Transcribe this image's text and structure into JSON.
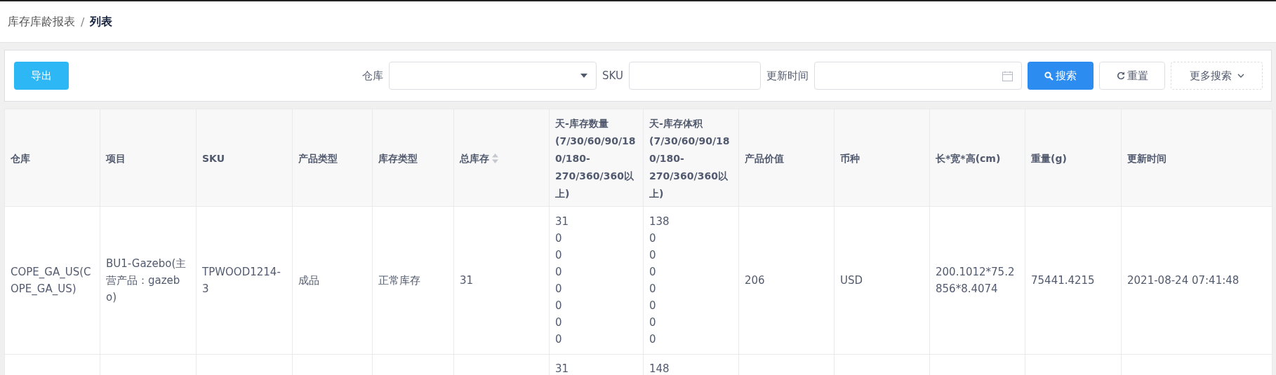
{
  "breadcrumb": {
    "items": [
      {
        "label": "库存库龄报表",
        "current": false
      },
      {
        "label": "列表",
        "current": true
      }
    ],
    "separator": "/"
  },
  "toolbar": {
    "export_button": "导出",
    "filters": [
      {
        "kind": "select",
        "label": "仓库"
      },
      {
        "kind": "text",
        "label": "SKU"
      },
      {
        "kind": "date",
        "label": "更新时间"
      }
    ],
    "search_button": "搜索",
    "reset_button": "重置",
    "more_button": "更多搜索"
  },
  "table": {
    "columns": [
      {
        "label": "仓库",
        "sortable": false
      },
      {
        "label": "项目",
        "sortable": false
      },
      {
        "label": "SKU",
        "sortable": false
      },
      {
        "label": "产品类型",
        "sortable": false
      },
      {
        "label": "库存类型",
        "sortable": false
      },
      {
        "label": "总库存",
        "sortable": true
      },
      {
        "label": "天-库存数量 (7/30/60/90/180/180-270/360/360以上)",
        "sortable": false
      },
      {
        "label": "天-库存体积 (7/30/60/90/180/180-270/360/360以上)",
        "sortable": false
      },
      {
        "label": "产品价值",
        "sortable": false
      },
      {
        "label": "币种",
        "sortable": false
      },
      {
        "label": "长*宽*高(cm)",
        "sortable": false
      },
      {
        "label": "重量(g)",
        "sortable": false
      },
      {
        "label": "更新时间",
        "sortable": false
      }
    ],
    "rows": [
      {
        "cells": [
          [
            "COPE_GA_US(COPE_GA_US)"
          ],
          [
            "BU1-Gazebo(主营产品：gazebo)"
          ],
          [
            "TPWOOD1214-3"
          ],
          [
            "成品"
          ],
          [
            "正常库存"
          ],
          [
            "31"
          ],
          [
            "31",
            "0",
            "0",
            "0",
            "0",
            "0",
            "0",
            "0"
          ],
          [
            "138",
            "0",
            "0",
            "0",
            "0",
            "0",
            "0",
            "0"
          ],
          [
            "206"
          ],
          [
            "USD"
          ],
          [
            "200.1012*75.2856*8.4074"
          ],
          [
            "75441.4215"
          ],
          [
            "2021-08-24 07:41:48"
          ]
        ]
      },
      {
        "cells": [
          null,
          null,
          null,
          null,
          null,
          null,
          [
            "31"
          ],
          [
            "148"
          ],
          null,
          null,
          null,
          null,
          null
        ]
      }
    ]
  }
}
